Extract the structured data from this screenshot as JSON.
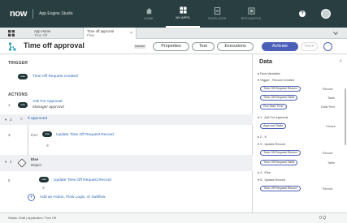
{
  "topbar": {
    "logo": "now",
    "app_name": "App Engine Studio",
    "nav": [
      {
        "label": "HOME",
        "icon": "home-icon"
      },
      {
        "label": "MY APPS",
        "icon": "apps-grid-icon"
      },
      {
        "label": "TEMPLATES",
        "icon": "templates-icon"
      },
      {
        "label": "RESOURCES",
        "icon": "resources-icon"
      }
    ],
    "active_nav": "MY APPS",
    "help": "?"
  },
  "tabs": [
    {
      "title": "App Home",
      "subtitle": "Time Off"
    },
    {
      "title": "Time off approval",
      "subtitle": "Flow",
      "close": "×"
    }
  ],
  "flow": {
    "title": "Time off approval",
    "status_badge": "Inactive",
    "buttons": {
      "properties": "Properties",
      "test": "Test",
      "executions": "Executions",
      "activate": "Activate",
      "save": "Save",
      "more": "⋯"
    }
  },
  "trigger": {
    "header": "TRIGGER",
    "label": "Time Off Request Created"
  },
  "actions": {
    "header": "ACTIONS",
    "items": [
      {
        "num": "1",
        "title": "Ask For Approval",
        "subtitle": "Manager approval"
      },
      {
        "num": "2",
        "title": "If approved"
      },
      {
        "num": "3",
        "title": "Update Time Off Request Record",
        "prefix": "then"
      },
      {
        "num": "4",
        "title": "Else",
        "subtitle": "Reject"
      },
      {
        "num": "5",
        "title": "Update Time Off Request Record"
      }
    ],
    "add_label": "Add an Action, Flow Logic, or Subflow"
  },
  "data_panel": {
    "header": "Data",
    "sections": [
      {
        "label": "▸ Flow Variables"
      },
      {
        "label": "▾ Trigger - Record Created",
        "pills": [
          {
            "label": "Time Off Request Record",
            "type": "Record"
          },
          {
            "label": "Time Off Request Table",
            "type": "Table"
          },
          {
            "label": "Run Start Time",
            "type": "Date/Time"
          }
        ]
      },
      {
        "label": "▾ 1 - Ask For Approval",
        "pills": [
          {
            "label": "Approval State",
            "type": "Choice"
          }
        ]
      },
      {
        "label": "▸ 2 - If"
      },
      {
        "label": "▾ 3 - Update Record",
        "pills": [
          {
            "label": "Time Off Request Record",
            "type": "Record"
          },
          {
            "label": "Time Off Request Table",
            "type": "Table"
          }
        ]
      },
      {
        "label": "▸ 4 - Else"
      },
      {
        "label": "▾ 5 - Update Record",
        "pills": [
          {
            "label": "Time Off Request Record",
            "type": "Record"
          }
        ]
      }
    ]
  },
  "status_bar": {
    "text": "Status: Draft  |  Application: Time Off",
    "zoom": "0 Q"
  },
  "colors": {
    "topbar": "#293e40",
    "accent": "#4b5fb8",
    "link": "#2a66b7",
    "step_badge": "#1f3436"
  }
}
